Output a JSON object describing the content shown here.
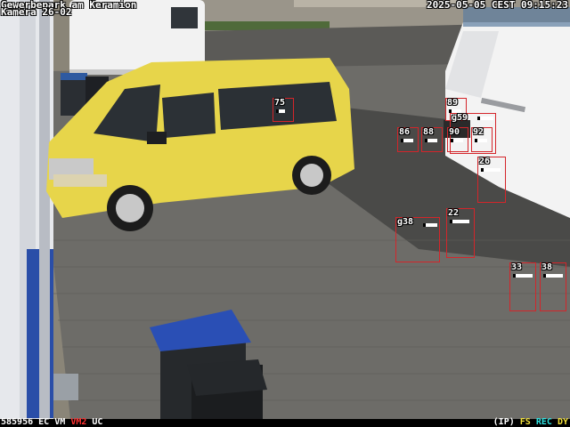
{
  "osd": {
    "location": "Gewerbepark am Keramion",
    "camera": "Kamera 26-02",
    "timestamp": "2025-05-05 CEST 09:15:23"
  },
  "status_bar": {
    "frame_counter": "585956",
    "flags_left": [
      "EC",
      "VM",
      "VM2",
      "UC"
    ],
    "flags_right": [
      "(IP)",
      "FS",
      "REC",
      "DY"
    ]
  },
  "detections": [
    {
      "label": "75"
    },
    {
      "label": "89"
    },
    {
      "label": "g59"
    },
    {
      "label": "86"
    },
    {
      "label": "88"
    },
    {
      "label": "90"
    },
    {
      "label": "92"
    },
    {
      "label": "26"
    },
    {
      "label": "22"
    },
    {
      "label": "g38"
    },
    {
      "label": "33"
    },
    {
      "label": "38"
    }
  ],
  "colors": {
    "detection_box": "#d4252a",
    "flag_vm2": "#ff3030",
    "flag_fs": "#f4e23c",
    "flag_rec": "#2ee0e0",
    "flag_dy": "#f4e23c"
  }
}
